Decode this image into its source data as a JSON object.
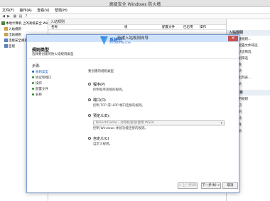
{
  "window": {
    "title": "高级安全 Windows 防火墙"
  },
  "menu": [
    "文件(F)",
    "操作(A)",
    "查看(V)",
    "帮助(H)"
  ],
  "tree": {
    "root": "本地计算机 上的高级安全 Win",
    "items": [
      "入站规则",
      "出站规则",
      "连接安全规则",
      "监视"
    ]
  },
  "list": {
    "header": "入站规则",
    "columns": [
      "名称",
      "组",
      "配置文件",
      "已启用",
      "操作"
    ]
  },
  "actions": {
    "section1": "入站规则",
    "items1": [
      "新建规则...",
      "按配置文件筛选",
      "按状态筛选",
      "按组筛选",
      "查看",
      "刷新",
      "导出列表...",
      "帮助"
    ],
    "section2": "所选项目",
    "items2": [
      "禁用规则",
      "剪切",
      "复制",
      "删除",
      "属性",
      "帮助"
    ]
  },
  "watermark": {
    "line1": "系统分",
    "line2": "XITONGFEN.COM"
  },
  "dialog": {
    "title": "新建入站规则向导",
    "close": "✕",
    "heading": "规则类型",
    "subheading": "选择要创建的防火墙规则类型",
    "steps_label": "步骤:",
    "steps": [
      "规则类型",
      "协议和端口",
      "操作",
      "配置文件",
      "名称"
    ],
    "question": "要创建的规则类型",
    "options": [
      {
        "label": "程序(P)",
        "desc": "控制程序连接的规则。"
      },
      {
        "label": "端口(O)",
        "desc": "控制 TCP 或 UDP 端口连接的规则。"
      },
      {
        "label": "预定义(E):",
        "desc": "控制 Windows 体验功能连接的规则。"
      },
      {
        "label": "自定义(C)",
        "desc": "自定义规则。"
      }
    ],
    "predefined_value": "BranchCache - 对等机发现(使用 WSD)",
    "buttons": {
      "back": "< 上一步(B)",
      "next": "下一步(N) >",
      "cancel": "取消"
    }
  }
}
